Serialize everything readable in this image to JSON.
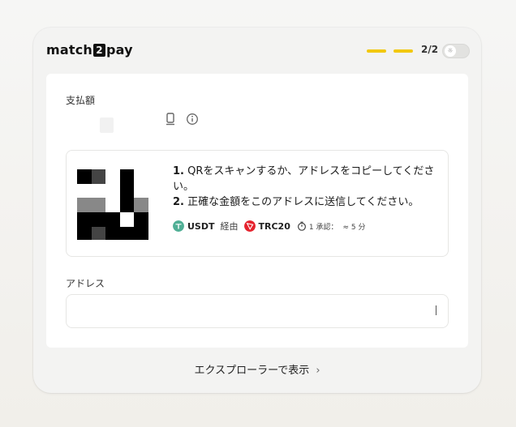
{
  "brand": {
    "logo_prefix": "match",
    "logo_digit": "2",
    "logo_suffix": "pay"
  },
  "header": {
    "step": "2/2",
    "progress_completed": 2,
    "progress_total": 2
  },
  "payment": {
    "amount_label": "支払額",
    "amount_value": ""
  },
  "qr_section": {
    "instructions": [
      {
        "num": "1.",
        "text": "QRをスキャンするか、アドレスをコピーしてください。"
      },
      {
        "num": "2.",
        "text": "正確な金額をこのアドレスに送信してください。"
      }
    ],
    "token": "USDT",
    "via": "経由",
    "network": "TRC20",
    "confirmations": "1 承認：",
    "eta": "≈ 5 分"
  },
  "address": {
    "label": "アドレス",
    "value": ""
  },
  "footer": {
    "explorer_link": "エクスプローラーで表示"
  },
  "colors": {
    "accent_yellow": "#f2c811",
    "usdt_green": "#50af95",
    "tron_red": "#e5222d"
  },
  "icons": [
    "copy-icon",
    "info-icon",
    "usdt-icon",
    "tron-icon",
    "timer-icon",
    "chevron-right-icon",
    "theme-toggle-icon"
  ]
}
